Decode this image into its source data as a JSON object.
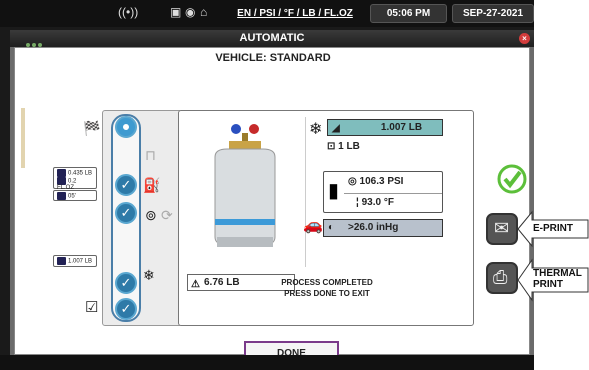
{
  "statusbar": {
    "wifi_icon": "wifi-icon",
    "units": "EN / PSI / °F / LB / FL.OZ",
    "time": "05:06 PM",
    "date": "SEP-27-2021"
  },
  "window": {
    "title": "AUTOMATIC",
    "close_glyph": "×"
  },
  "vehicle_label": "VEHICLE: STANDARD",
  "left_readouts": {
    "r1": "0.435 LB",
    "r2": "0.2 FL.OZ",
    "r3": "05'",
    "r4": "1.007 LB"
  },
  "tank_weight": "6.76 LB",
  "refrigerant": {
    "charged": "1.007 LB",
    "target": "1 LB",
    "pressure": "106.3 PSI",
    "temperature": "93.0 °F",
    "vacuum": ">26.0 inHg"
  },
  "process": {
    "line1": "PROCESS COMPLETED",
    "line2": "PRESS DONE TO EXIT"
  },
  "done_label": "DONE",
  "side_buttons": {
    "eprint": "E-PRINT",
    "thermal_line1": "THERMAL",
    "thermal_line2": "PRINT"
  },
  "colors": {
    "accent": "#2e7aa8",
    "success": "#5cbf3a",
    "highlight": "#7fbdbd"
  }
}
